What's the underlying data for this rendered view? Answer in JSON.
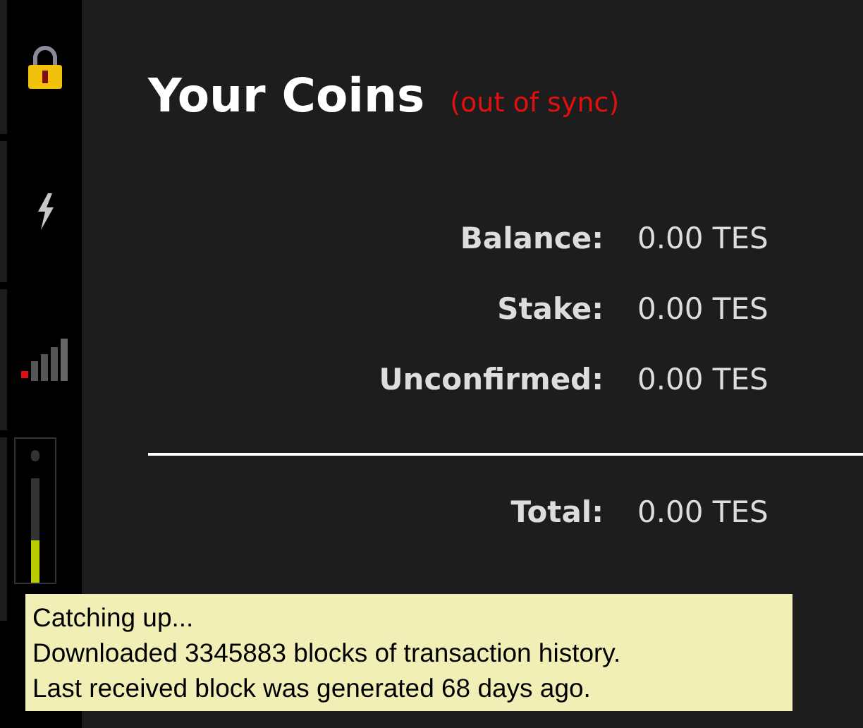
{
  "title": "Your Coins",
  "sync_status": "(out of sync)",
  "balances": [
    {
      "label": "Balance:",
      "value": "0.00 TES"
    },
    {
      "label": "Stake:",
      "value": "0.00 TES"
    },
    {
      "label": "Unconfirmed:",
      "value": "0.00 TES"
    }
  ],
  "total": {
    "label": "Total:",
    "value": "0.00 TES"
  },
  "sync_meter": {
    "level": 0.4
  },
  "tooltip": [
    "Catching up...",
    "Downloaded 3345883 blocks of transaction history.",
    "Last received block was generated 68 days ago."
  ]
}
